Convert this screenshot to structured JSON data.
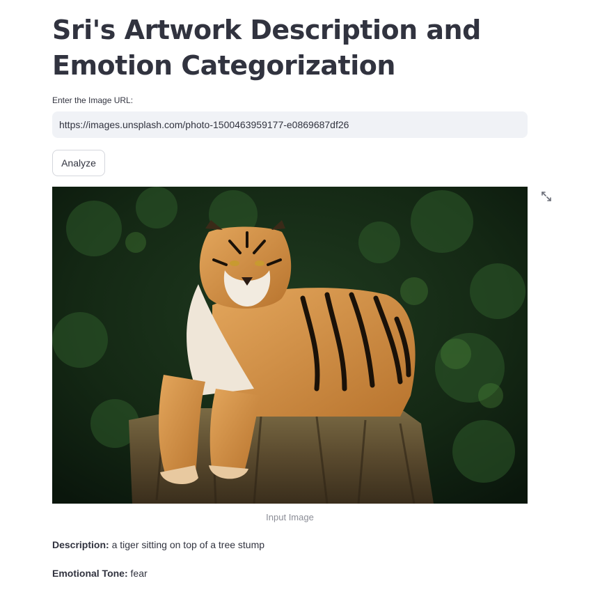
{
  "page": {
    "title": "Sri's Artwork Description and Emotion Categorization"
  },
  "form": {
    "url_label": "Enter the Image URL:",
    "url_value": "https://images.unsplash.com/photo-1500463959177-e0869687df26",
    "analyze_label": "Analyze"
  },
  "image": {
    "caption": "Input Image",
    "fullscreen_icon": "expand-arrows-icon"
  },
  "results": {
    "description_key": "Description:",
    "description_value": "a tiger sitting on top of a tree stump",
    "tone_key": "Emotional Tone:",
    "tone_value": "fear"
  },
  "colors": {
    "text": "#31333f",
    "input_bg": "#f0f2f6",
    "caption": "#8b8d96",
    "button_border": "#d4d6dc"
  }
}
